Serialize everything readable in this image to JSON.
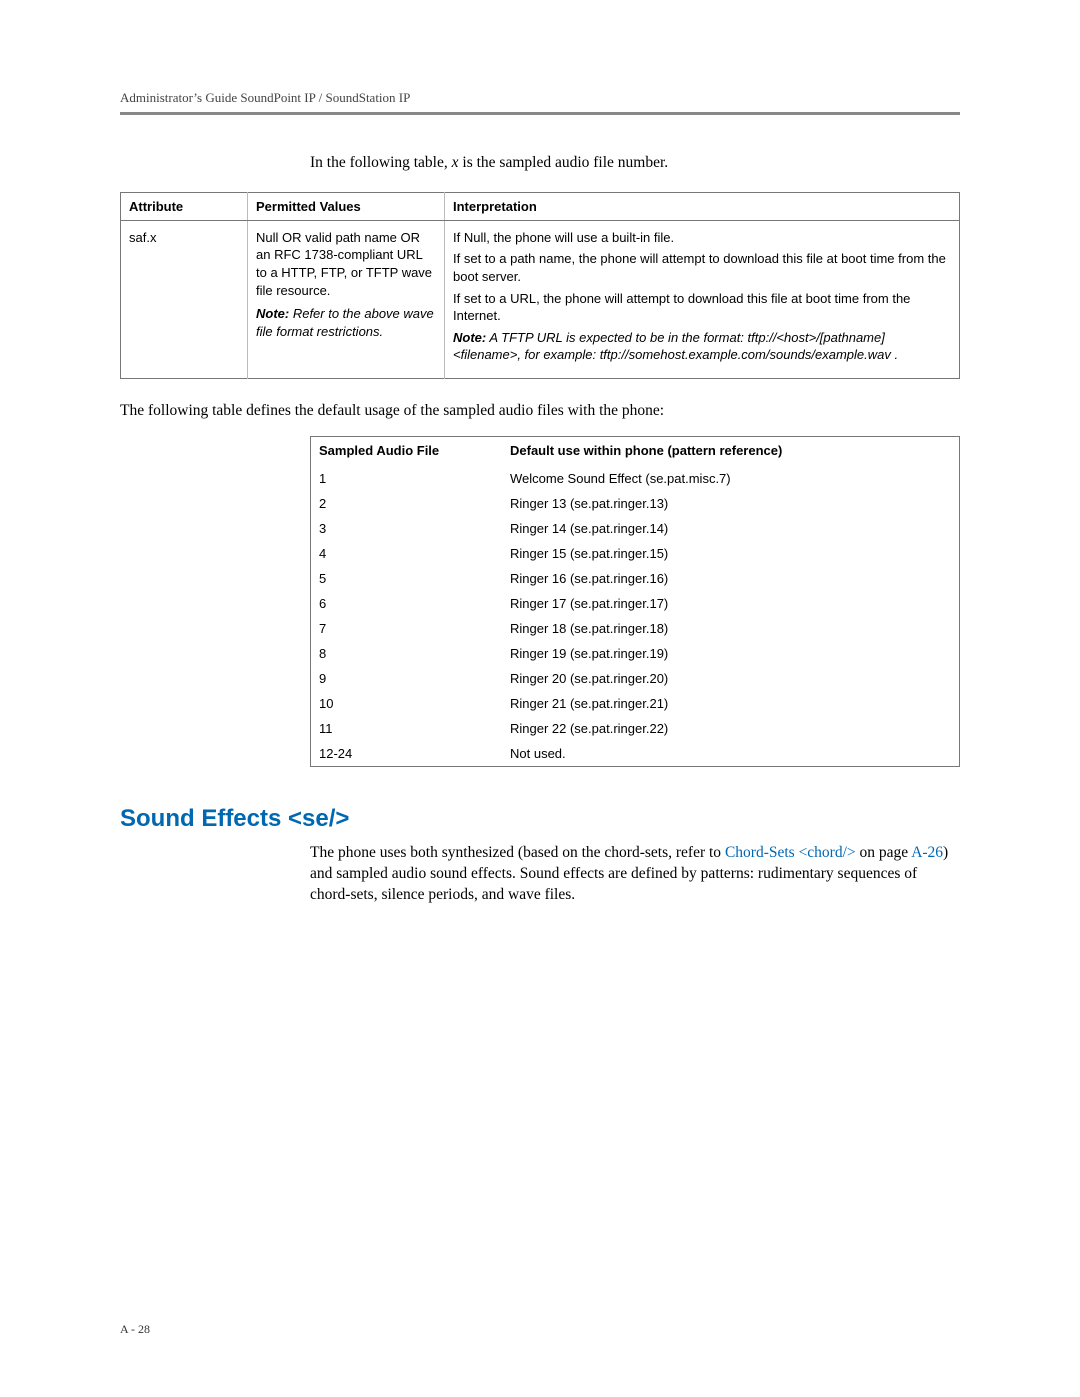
{
  "header": {
    "running": "Administrator’s Guide SoundPoint IP / SoundStation IP"
  },
  "intro1_pre": "In the following table, ",
  "intro1_var": "x",
  "intro1_post": " is the sampled audio file number.",
  "table1": {
    "headers": {
      "attr": "Attribute",
      "perm": "Permitted Values",
      "interp": "Interpretation"
    },
    "row": {
      "attr": "saf.x",
      "perm_main": "Null OR valid path name OR an RFC 1738-compliant URL to a HTTP, FTP, or TFTP wave file resource.",
      "perm_note_label": "Note:",
      "perm_note_rest": " Refer to the above wave file format restrictions.",
      "int_l1": "If Null, the phone will use a built-in file.",
      "int_l2": "If set to a path name, the phone will attempt to download this file at boot time from the boot server.",
      "int_l3": "If set to a URL, the phone will attempt to download this file at boot time from the Internet.",
      "int_note_label": "Note:",
      "int_note_body": " A TFTP URL is expected to be in the format: tftp://<host>/[pathname]<filename>, for example: tftp://somehost.example.com/sounds/example.wav ."
    }
  },
  "intro2": "The following table defines the default usage of the sampled audio files with the phone:",
  "table2": {
    "headers": {
      "saf": "Sampled Audio File",
      "use": "Default use within phone (pattern reference)"
    },
    "rows": [
      {
        "saf": "1",
        "use": "Welcome Sound Effect (se.pat.misc.7)"
      },
      {
        "saf": "2",
        "use": "Ringer 13 (se.pat.ringer.13)"
      },
      {
        "saf": "3",
        "use": "Ringer 14 (se.pat.ringer.14)"
      },
      {
        "saf": "4",
        "use": "Ringer 15 (se.pat.ringer.15)"
      },
      {
        "saf": "5",
        "use": "Ringer 16 (se.pat.ringer.16)"
      },
      {
        "saf": "6",
        "use": "Ringer 17 (se.pat.ringer.17)"
      },
      {
        "saf": "7",
        "use": "Ringer 18 (se.pat.ringer.18)"
      },
      {
        "saf": "8",
        "use": "Ringer 19 (se.pat.ringer.19)"
      },
      {
        "saf": "9",
        "use": "Ringer 20 (se.pat.ringer.20)"
      },
      {
        "saf": "10",
        "use": "Ringer 21 (se.pat.ringer.21)"
      },
      {
        "saf": "11",
        "use": "Ringer 22 (se.pat.ringer.22)"
      },
      {
        "saf": "12-24",
        "use": "Not used."
      }
    ]
  },
  "section": {
    "title": "Sound Effects <se/>",
    "p_pre": "The phone uses both synthesized (based on the chord-sets, refer to ",
    "p_link": "Chord-Sets <chord/>",
    "p_mid": " on page ",
    "p_pageref": "A-26",
    "p_post": ") and sampled audio sound effects. Sound effects are defined by patterns: rudimentary sequences of chord-sets, silence periods, and wave files."
  },
  "footer": {
    "page": "A - 28"
  }
}
